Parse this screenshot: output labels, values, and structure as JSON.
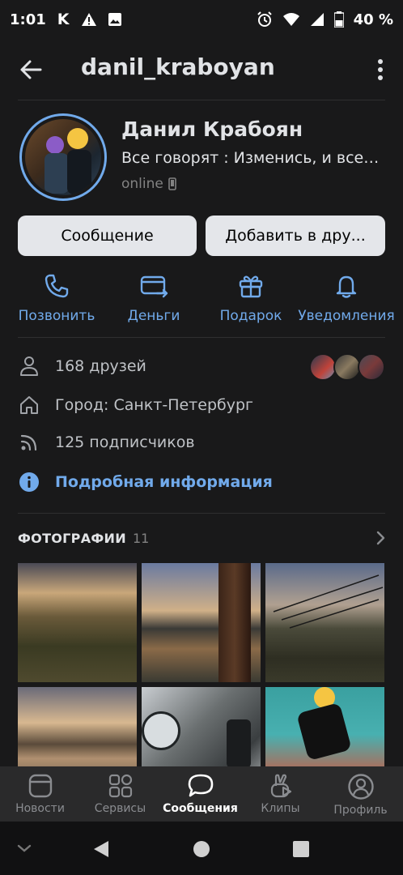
{
  "status_bar": {
    "time": "1:01",
    "carrier_icon": "K",
    "battery": "40 %"
  },
  "header": {
    "title": "danil_kraboyan"
  },
  "profile": {
    "name": "Данил Крабоян",
    "status": "Все говорят : Изменись, и все з...",
    "online": "online"
  },
  "buttons": {
    "message": "Сообщение",
    "add_friend": "Добавить в дру..."
  },
  "actions": [
    {
      "label": "Позвонить",
      "icon": "phone-icon"
    },
    {
      "label": "Деньги",
      "icon": "money-card-icon"
    },
    {
      "label": "Подарок",
      "icon": "gift-icon"
    },
    {
      "label": "Уведомления",
      "icon": "bell-icon"
    }
  ],
  "info": {
    "friends": "168 друзей",
    "city": "Город: Санкт-Петербург",
    "followers": "125 подписчиков",
    "details": "Подробная информация"
  },
  "photos": {
    "title": "ФОТОГРАФИИ",
    "count": "11"
  },
  "tabs": [
    {
      "label": "Новости",
      "icon": "news-icon"
    },
    {
      "label": "Сервисы",
      "icon": "services-icon"
    },
    {
      "label": "Сообщения",
      "icon": "messages-icon",
      "active": true
    },
    {
      "label": "Клипы",
      "icon": "clips-icon"
    },
    {
      "label": "Профиль",
      "icon": "profile-icon"
    }
  ],
  "colors": {
    "background": "#19191a",
    "accent": "#71aaeb",
    "button": "#e4e6ea",
    "tabbar": "#2a2a2b"
  }
}
